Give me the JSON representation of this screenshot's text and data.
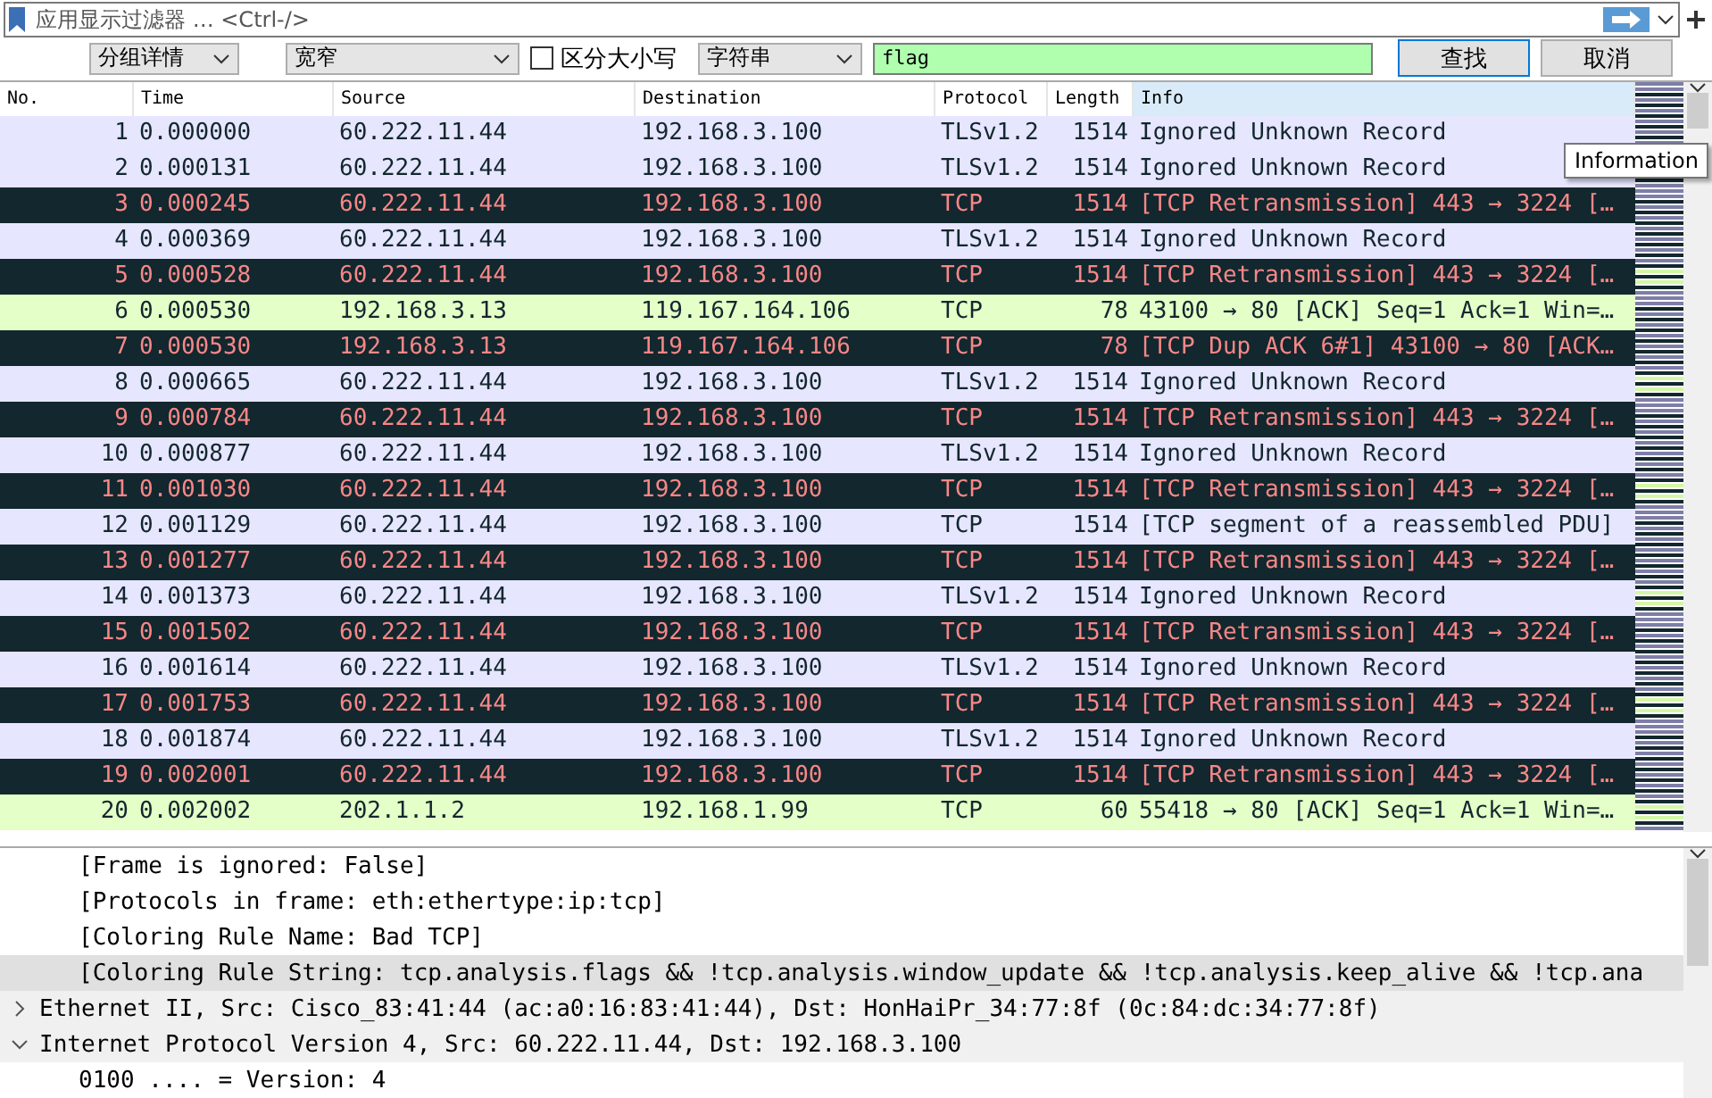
{
  "filter_bar": {
    "placeholder": "应用显示过滤器 … <Ctrl-/>"
  },
  "find_bar": {
    "search_in": "分组详情",
    "char_width": "宽窄",
    "case_sensitive": false,
    "case_label": "区分大小写",
    "type": "字符串",
    "query": "flag",
    "find": "查找",
    "cancel": "取消"
  },
  "columns": [
    "No.",
    "Time",
    "Source",
    "Destination",
    "Protocol",
    "Length",
    "Info"
  ],
  "rows": [
    {
      "kind": "normal",
      "cells": [
        "1",
        "0.000000",
        "60.222.11.44",
        "192.168.3.100",
        "TLSv1.2",
        "1514",
        "Ignored Unknown Record"
      ]
    },
    {
      "kind": "normal",
      "cells": [
        "2",
        "0.000131",
        "60.222.11.44",
        "192.168.3.100",
        "TLSv1.2",
        "1514",
        "Ignored Unknown Record"
      ]
    },
    {
      "kind": "bad",
      "cells": [
        "3",
        "0.000245",
        "60.222.11.44",
        "192.168.3.100",
        "TCP",
        "1514",
        "[TCP Retransmission] 443 → 3224 […"
      ]
    },
    {
      "kind": "normal",
      "cells": [
        "4",
        "0.000369",
        "60.222.11.44",
        "192.168.3.100",
        "TLSv1.2",
        "1514",
        "Ignored Unknown Record"
      ]
    },
    {
      "kind": "bad",
      "cells": [
        "5",
        "0.000528",
        "60.222.11.44",
        "192.168.3.100",
        "TCP",
        "1514",
        "[TCP Retransmission] 443 → 3224 […"
      ]
    },
    {
      "kind": "green",
      "cells": [
        "6",
        "0.000530",
        "192.168.3.13",
        "119.167.164.106",
        "TCP",
        "78",
        "43100 → 80 [ACK] Seq=1 Ack=1 Win=…"
      ]
    },
    {
      "kind": "bad",
      "cells": [
        "7",
        "0.000530",
        "192.168.3.13",
        "119.167.164.106",
        "TCP",
        "78",
        "[TCP Dup ACK 6#1] 43100 → 80 [ACK…"
      ]
    },
    {
      "kind": "normal",
      "cells": [
        "8",
        "0.000665",
        "60.222.11.44",
        "192.168.3.100",
        "TLSv1.2",
        "1514",
        "Ignored Unknown Record"
      ]
    },
    {
      "kind": "bad",
      "cells": [
        "9",
        "0.000784",
        "60.222.11.44",
        "192.168.3.100",
        "TCP",
        "1514",
        "[TCP Retransmission] 443 → 3224 […"
      ]
    },
    {
      "kind": "normal",
      "cells": [
        "10",
        "0.000877",
        "60.222.11.44",
        "192.168.3.100",
        "TLSv1.2",
        "1514",
        "Ignored Unknown Record"
      ]
    },
    {
      "kind": "bad",
      "cells": [
        "11",
        "0.001030",
        "60.222.11.44",
        "192.168.3.100",
        "TCP",
        "1514",
        "[TCP Retransmission] 443 → 3224 […"
      ]
    },
    {
      "kind": "normal",
      "cells": [
        "12",
        "0.001129",
        "60.222.11.44",
        "192.168.3.100",
        "TCP",
        "1514",
        "[TCP segment of a reassembled PDU]"
      ]
    },
    {
      "kind": "bad",
      "cells": [
        "13",
        "0.001277",
        "60.222.11.44",
        "192.168.3.100",
        "TCP",
        "1514",
        "[TCP Retransmission] 443 → 3224 […"
      ]
    },
    {
      "kind": "normal",
      "cells": [
        "14",
        "0.001373",
        "60.222.11.44",
        "192.168.3.100",
        "TLSv1.2",
        "1514",
        "Ignored Unknown Record"
      ]
    },
    {
      "kind": "bad",
      "cells": [
        "15",
        "0.001502",
        "60.222.11.44",
        "192.168.3.100",
        "TCP",
        "1514",
        "[TCP Retransmission] 443 → 3224 […"
      ]
    },
    {
      "kind": "normal",
      "cells": [
        "16",
        "0.001614",
        "60.222.11.44",
        "192.168.3.100",
        "TLSv1.2",
        "1514",
        "Ignored Unknown Record"
      ]
    },
    {
      "kind": "bad",
      "cells": [
        "17",
        "0.001753",
        "60.222.11.44",
        "192.168.3.100",
        "TCP",
        "1514",
        "[TCP Retransmission] 443 → 3224 […"
      ]
    },
    {
      "kind": "normal",
      "cells": [
        "18",
        "0.001874",
        "60.222.11.44",
        "192.168.3.100",
        "TLSv1.2",
        "1514",
        "Ignored Unknown Record"
      ]
    },
    {
      "kind": "bad",
      "cells": [
        "19",
        "0.002001",
        "60.222.11.44",
        "192.168.3.100",
        "TCP",
        "1514",
        "[TCP Retransmission] 443 → 3224 […"
      ]
    },
    {
      "kind": "green",
      "cells": [
        "20",
        "0.002002",
        "202.1.1.2",
        "192.168.1.99",
        "TCP",
        "60",
        "55418 → 80 [ACK] Seq=1 Ack=1 Win=…"
      ]
    }
  ],
  "tooltip": "Information",
  "detail": {
    "frame_children": [
      {
        "text": "[Frame is ignored: False]",
        "selected": false
      },
      {
        "text": "[Protocols in frame: eth:ethertype:ip:tcp]",
        "selected": false
      },
      {
        "text": "[Coloring Rule Name: Bad TCP]",
        "selected": false
      },
      {
        "text": "[Coloring Rule String: tcp.analysis.flags && !tcp.analysis.window_update && !tcp.analysis.keep_alive && !tcp.ana",
        "selected": true
      }
    ],
    "nodes": [
      {
        "text": "Ethernet II, Src: Cisco_83:41:44 (ac:a0:16:83:41:44), Dst: HonHaiPr_34:77:8f (0c:84:dc:34:77:8f)",
        "expanded": false
      },
      {
        "text": "Internet Protocol Version 4, Src: 60.222.11.44, Dst: 192.168.3.100",
        "expanded": true,
        "children": [
          {
            "text": "0100 .... = Version: 4"
          }
        ]
      }
    ]
  }
}
